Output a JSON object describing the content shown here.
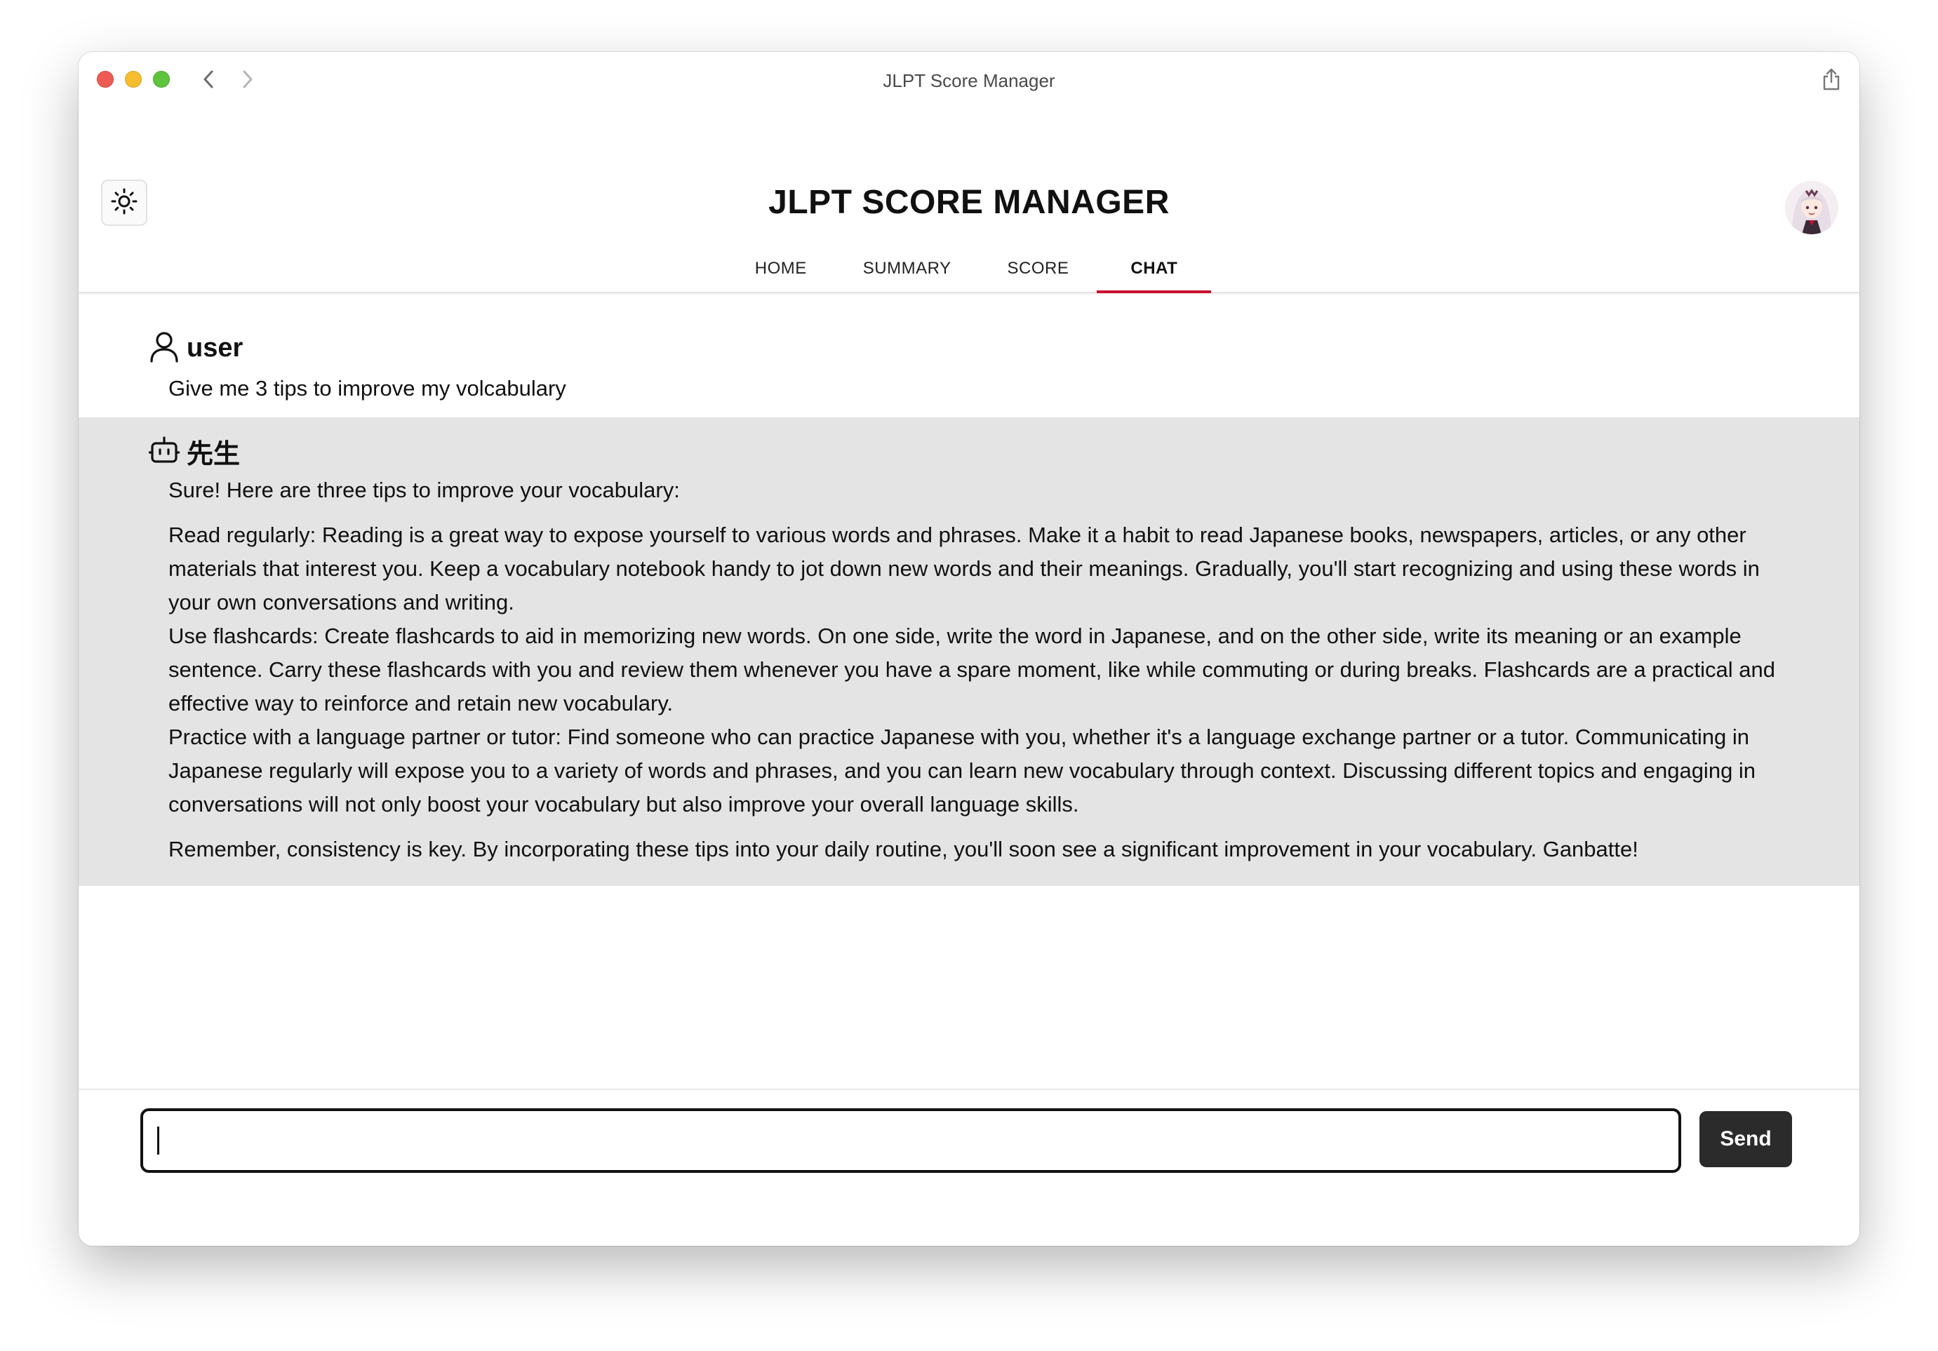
{
  "window": {
    "title": "JLPT Score Manager"
  },
  "header": {
    "app_title": "JLPT SCORE MANAGER",
    "theme_icon": "sun-icon",
    "tabs": [
      {
        "label": "HOME",
        "active": false
      },
      {
        "label": "SUMMARY",
        "active": false
      },
      {
        "label": "SCORE",
        "active": false
      },
      {
        "label": "CHAT",
        "active": true
      }
    ]
  },
  "colors": {
    "accent": "#c8102e",
    "bot_bg": "#e4e4e4",
    "send_bg": "#2b2b2b"
  },
  "chat": {
    "messages": [
      {
        "role": "user",
        "icon": "user-icon",
        "text": "Give me 3 tips to improve my volcabulary"
      },
      {
        "role": "先生",
        "icon": "robot-icon",
        "intro": "Sure! Here are three tips to improve your vocabulary:",
        "tips": [
          "Read regularly: Reading is a great way to expose yourself to various words and phrases. Make it a habit to read Japanese books, newspapers, articles, or any other materials that interest you. Keep a vocabulary notebook handy to jot down new words and their meanings. Gradually, you'll start recognizing and using these words in your own conversations and writing.",
          "Use flashcards: Create flashcards to aid in memorizing new words. On one side, write the word in Japanese, and on the other side, write its meaning or an example sentence. Carry these flashcards with you and review them whenever you have a spare moment, like while commuting or during breaks. Flashcards are a practical and effective way to reinforce and retain new vocabulary.",
          "Practice with a language partner or tutor: Find someone who can practice Japanese with you, whether it's a language exchange partner or a tutor. Communicating in Japanese regularly will expose you to a variety of words and phrases, and you can learn new vocabulary through context. Discussing different topics and engaging in conversations will not only boost your vocabulary but also improve your overall language skills."
        ],
        "outro": "Remember, consistency is key. By incorporating these tips into your daily routine, you'll soon see a significant improvement in your vocabulary. Ganbatte!"
      }
    ]
  },
  "composer": {
    "value": "",
    "send_label": "Send"
  }
}
